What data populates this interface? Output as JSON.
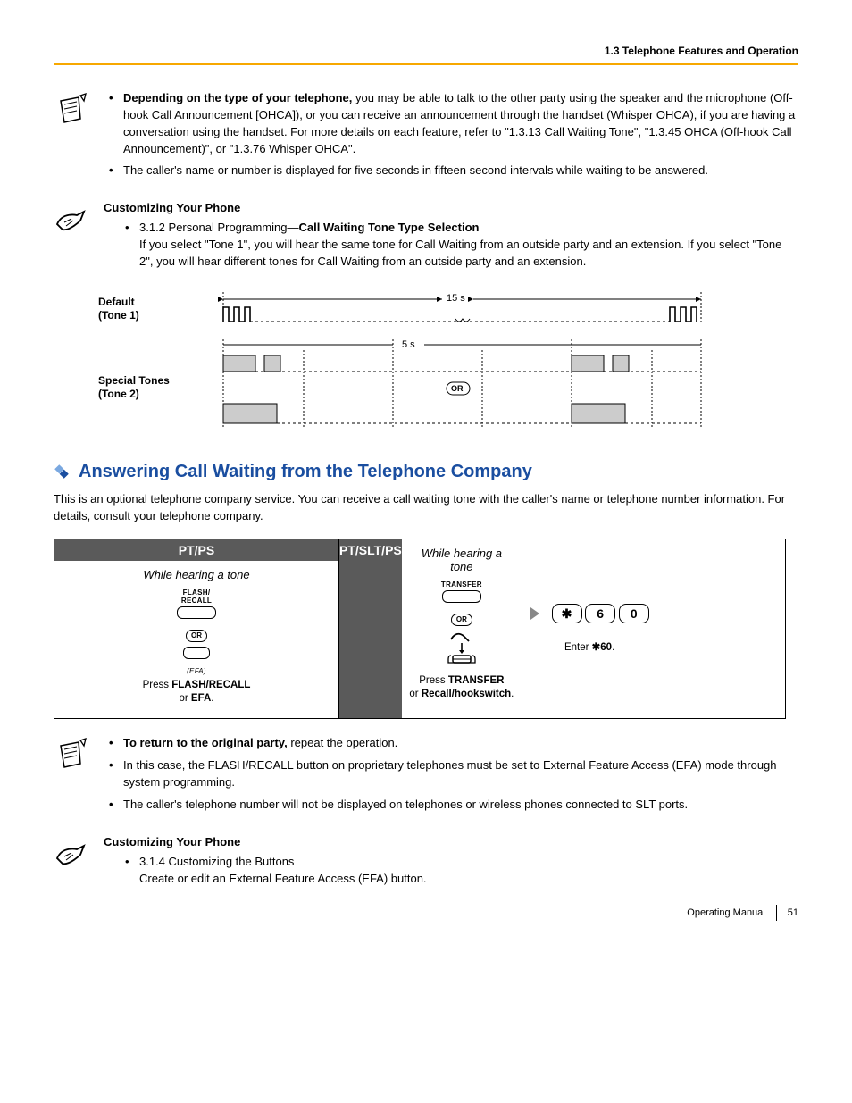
{
  "header": {
    "breadcrumb": "1.3 Telephone Features and Operation"
  },
  "block1": {
    "b1_lead": "Depending on the type of your telephone,",
    "b1_rest": " you may be able to talk to the other party using the speaker and the microphone (Off-hook Call Announcement [OHCA]), or you can receive an announcement through the handset (Whisper OHCA), if you are having a conversation using the handset. For more details on each feature, refer to \"1.3.13 Call Waiting Tone\", \"1.3.45 OHCA (Off-hook Call Announcement)\", or \"1.3.76 Whisper OHCA\".",
    "b2": "The caller's name or number is displayed for five seconds in fifteen second intervals while waiting to be answered."
  },
  "customize1": {
    "title": "Customizing Your Phone",
    "line1a": "3.1.2 Personal Programming—",
    "line1b": "Call Waiting Tone Type Selection",
    "line2": "If you select \"Tone 1\", you will hear the same tone for Call Waiting from an outside party and an extension. If you select \"Tone 2\", you will hear different tones for Call Waiting from an outside party and an extension."
  },
  "tone": {
    "label1a": "Default",
    "label1b": "(Tone 1)",
    "label2a": "Special Tones",
    "label2b": "(Tone 2)",
    "t15": "15 s",
    "t5": "5 s",
    "or": "OR"
  },
  "section2": {
    "heading": "Answering Call Waiting from the Telephone Company",
    "intro": "This is an optional telephone company service. You can receive a call waiting tone with the caller's name or telephone number information. For details, consult your telephone company."
  },
  "proc": {
    "h1": "PT/PS",
    "h2": "PT/SLT/PS",
    "sub1": "While hearing a tone",
    "sub2": "While hearing a tone",
    "flash_label": "FLASH/\nRECALL",
    "transfer_label": "TRANSFER",
    "efa": "(EFA)",
    "or": "OR",
    "cap1a": "Press ",
    "cap1b": "FLASH/RECALL",
    "cap1c": "\nor ",
    "cap1d": "EFA",
    "cap1e": ".",
    "cap2a": "Press ",
    "cap2b": "TRANSFER",
    "cap2c": "\nor ",
    "cap2d": "Recall/hookswitch",
    "cap2e": ".",
    "cap3a": "Enter ",
    "cap3b": "60",
    "cap3c": ".",
    "star": "✱",
    "d6": "6",
    "d0": "0"
  },
  "block2": {
    "b1_lead": "To return to the original party,",
    "b1_rest": " repeat the operation.",
    "b2": "In this case, the FLASH/RECALL button on proprietary telephones must be set to External Feature Access (EFA) mode through system programming.",
    "b3": "The caller's telephone number will not be displayed on telephones or wireless phones connected to SLT ports."
  },
  "customize2": {
    "title": "Customizing Your Phone",
    "line1": "3.1.4 Customizing the Buttons",
    "line2": "Create or edit an External Feature Access (EFA) button."
  },
  "footer": {
    "manual": "Operating Manual",
    "page": "51"
  }
}
